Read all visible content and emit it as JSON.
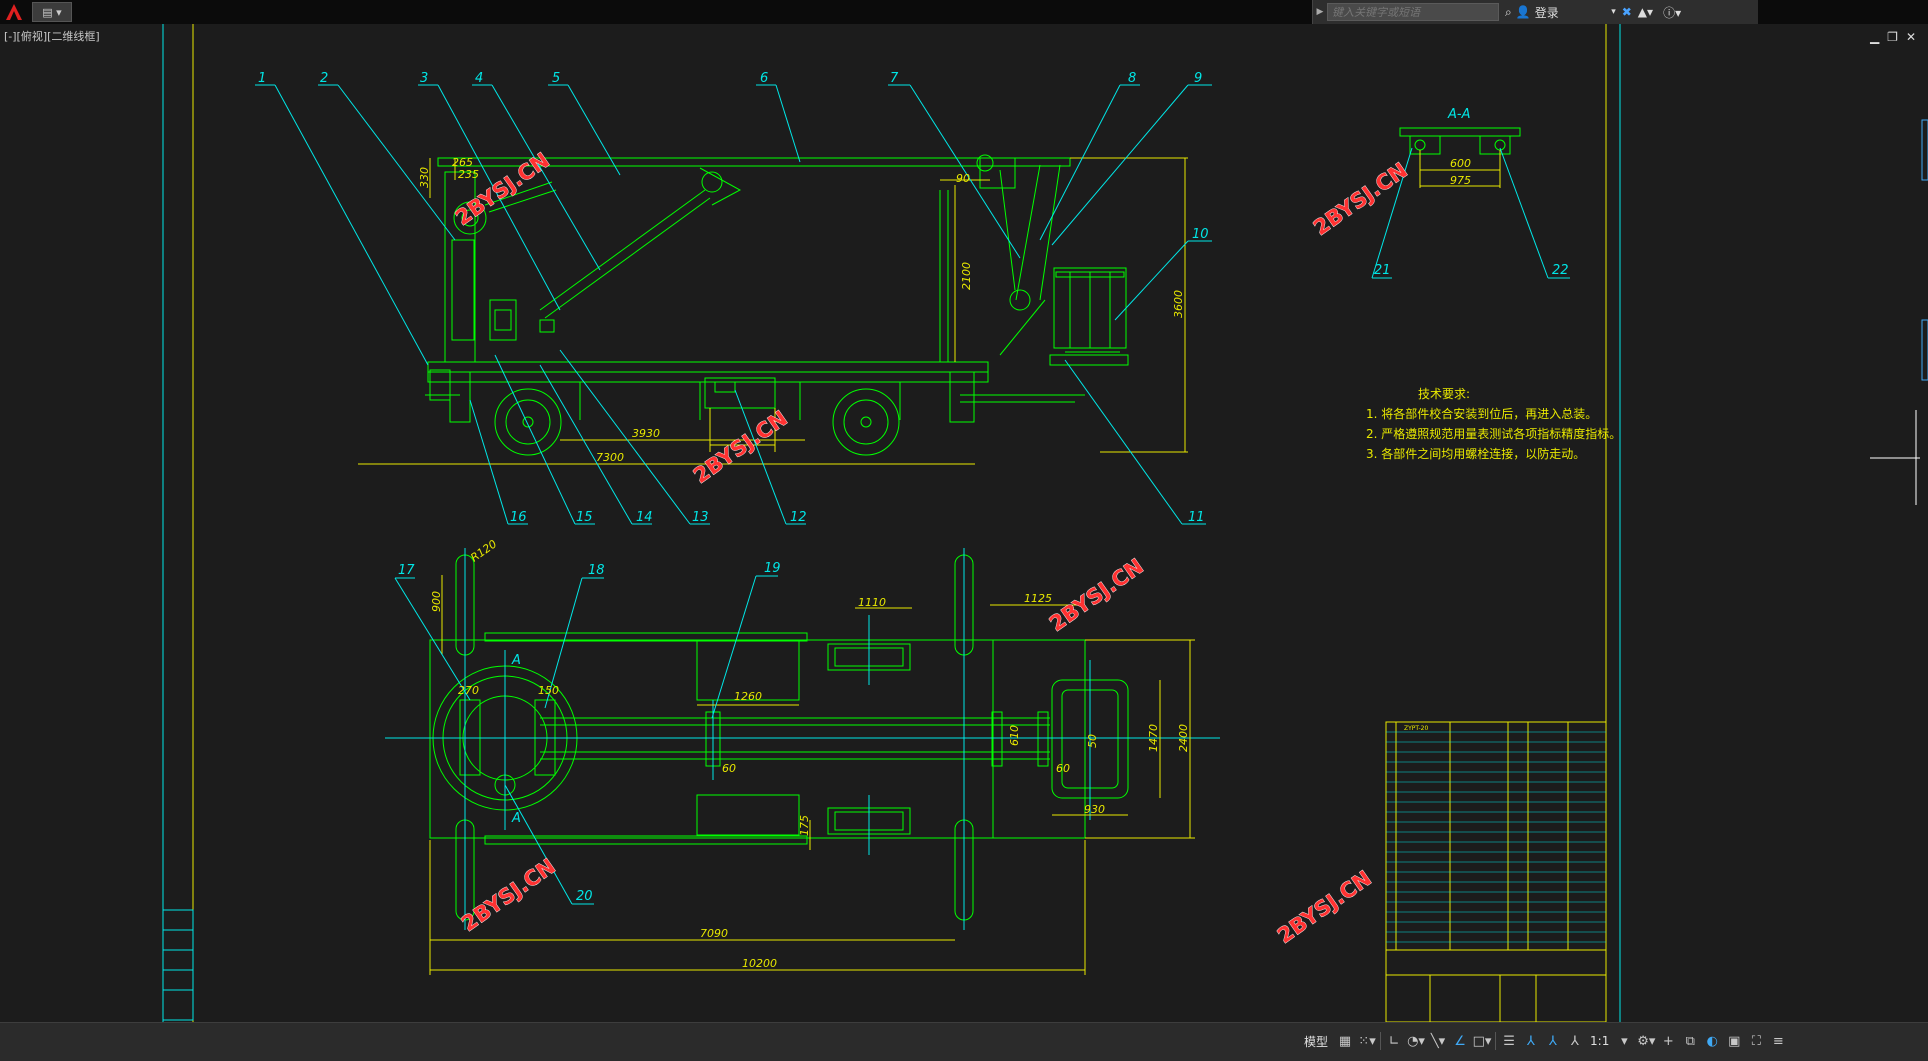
{
  "search": {
    "placeholder": "键入关键字或短语"
  },
  "infocenter": {
    "login_label": "登录"
  },
  "viewport": {
    "label": "[-][俯视][二维线框]"
  },
  "status": {
    "model_tab": "模型",
    "scale": "1:1"
  },
  "drawing": {
    "section_label": "A-A",
    "section_marks": [
      "A",
      "A"
    ],
    "callouts": [
      "1",
      "2",
      "3",
      "4",
      "5",
      "6",
      "7",
      "8",
      "9",
      "10",
      "11",
      "12",
      "13",
      "14",
      "15",
      "16",
      "17",
      "18",
      "19",
      "20",
      "21",
      "22"
    ],
    "dims": {
      "d330": "330",
      "d265": "265",
      "d235": "235",
      "d90": "90",
      "d2100": "2100",
      "d3600": "3600",
      "d3930": "3930",
      "d7300": "7300",
      "d600": "600",
      "d975": "975",
      "d1110": "1110",
      "d1125": "1125",
      "d1260": "1260",
      "d900": "900",
      "dR120": "R120",
      "d270": "270",
      "d150": "150",
      "d60a": "60",
      "d60b": "60",
      "d610": "610",
      "d1470": "1470",
      "d2400": "2400",
      "d930": "930",
      "d175": "175",
      "d7090": "7090",
      "d10200": "10200",
      "d50": "50"
    },
    "notes": {
      "title": "技术要求:",
      "line1": "1. 将各部件校合安装到位后，再进入总装。",
      "line2": "2. 严格遵照规范用量表测试各项指标精度指标。",
      "line3": "3. 各部件之间均用螺栓连接，以防走动。"
    },
    "watermark": "2BYSJ.CN",
    "bom_text": "ZYPT-20"
  },
  "colors": {
    "cyan": "#00e6e6",
    "green": "#00ff00",
    "yellow": "#e8e800",
    "background": "#1c1c1c",
    "watermark": "#ff3232"
  }
}
